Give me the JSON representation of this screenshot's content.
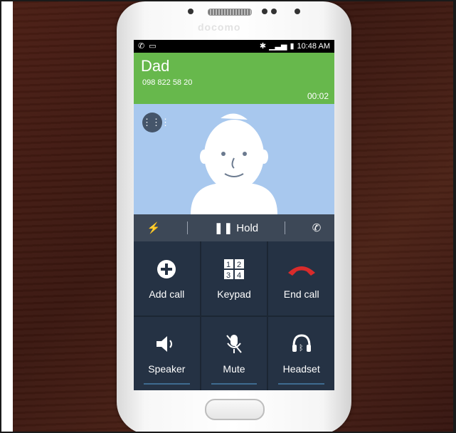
{
  "brand": "docomo",
  "status_bar": {
    "time": "10:48 AM"
  },
  "caller": {
    "name": "Dad",
    "number": "098 822 58 20",
    "duration": "00:02"
  },
  "controls": {
    "hold_label": "Hold"
  },
  "actions": [
    {
      "label": "Add call",
      "icon": "add-call-icon"
    },
    {
      "label": "Keypad",
      "icon": "keypad-icon"
    },
    {
      "label": "End call",
      "icon": "end-call-icon"
    },
    {
      "label": "Speaker",
      "icon": "speaker-icon"
    },
    {
      "label": "Mute",
      "icon": "mute-icon"
    },
    {
      "label": "Headset",
      "icon": "headset-icon"
    }
  ],
  "colors": {
    "caller_bar": "#67b84c",
    "photo_bg": "#a8c8ee",
    "end_call": "#d92b2b"
  }
}
